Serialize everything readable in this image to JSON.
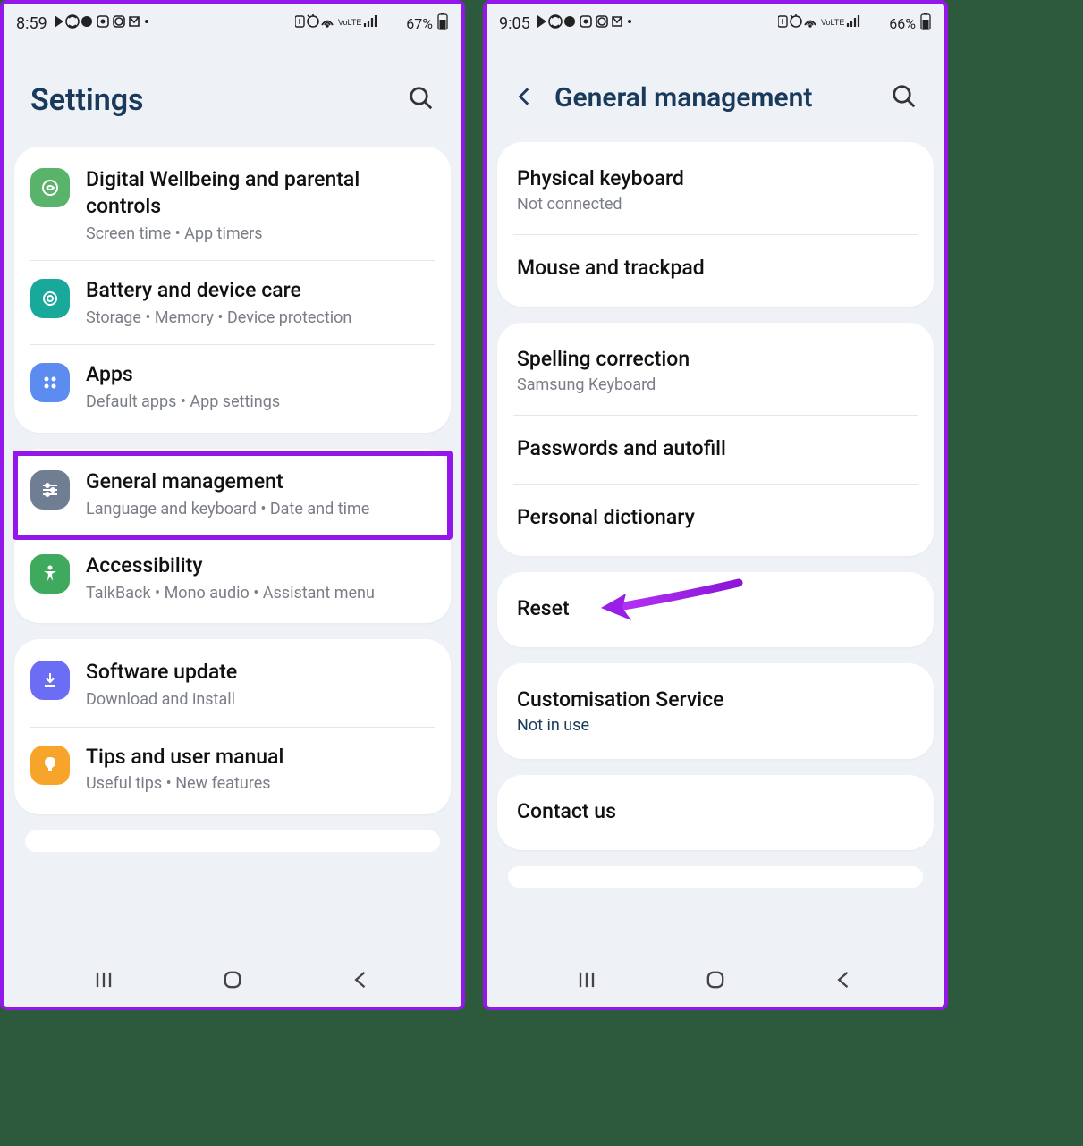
{
  "left": {
    "status": {
      "time": "8:59",
      "battery": "67%"
    },
    "title": "Settings",
    "groups": [
      {
        "items": [
          {
            "title": "Digital Wellbeing and parental controls",
            "sub": "Screen time  •  App timers",
            "iconColor": "#5ab36a",
            "iconName": "wellbeing-icon"
          },
          {
            "title": "Battery and device care",
            "sub": "Storage  •  Memory  •  Device protection",
            "iconColor": "#19a99a",
            "iconName": "device-care-icon"
          },
          {
            "title": "Apps",
            "sub": "Default apps  •  App settings",
            "iconColor": "#5d8cf0",
            "iconName": "apps-icon"
          }
        ]
      },
      {
        "items": [
          {
            "title": "General management",
            "sub": "Language and keyboard  •  Date and time",
            "iconColor": "#6f7e93",
            "iconName": "general-management-icon",
            "highlighted": true
          },
          {
            "title": "Accessibility",
            "sub": "TalkBack  •  Mono audio  •  Assistant menu",
            "iconColor": "#3fa95e",
            "iconName": "accessibility-icon"
          }
        ]
      },
      {
        "items": [
          {
            "title": "Software update",
            "sub": "Download and install",
            "iconColor": "#6b6ef5",
            "iconName": "software-update-icon"
          },
          {
            "title": "Tips and user manual",
            "sub": "Useful tips  •  New features",
            "iconColor": "#f7a52a",
            "iconName": "tips-icon"
          }
        ]
      }
    ]
  },
  "right": {
    "status": {
      "time": "9:05",
      "battery": "66%"
    },
    "title": "General management",
    "groups": [
      {
        "items": [
          {
            "title": "Physical keyboard",
            "sub": "Not connected"
          },
          {
            "title": "Mouse and trackpad"
          }
        ]
      },
      {
        "items": [
          {
            "title": "Spelling correction",
            "sub": "Samsung Keyboard"
          },
          {
            "title": "Passwords and autofill"
          },
          {
            "title": "Personal dictionary"
          }
        ]
      },
      {
        "items": [
          {
            "title": "Reset",
            "arrow": true
          }
        ]
      },
      {
        "items": [
          {
            "title": "Customisation Service",
            "sub": "Not in use",
            "subLink": true
          }
        ]
      },
      {
        "items": [
          {
            "title": "Contact us"
          }
        ]
      }
    ]
  }
}
